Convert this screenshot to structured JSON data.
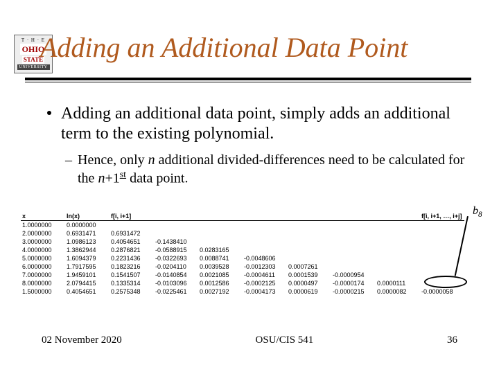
{
  "logo": {
    "line1": "T · H · E",
    "line2": "OHIO",
    "line3": "STATE",
    "line4": "UNIVERSITY"
  },
  "title": "Adding an Additional Data Point",
  "bullets": {
    "b1": "Adding an additional data point, simply adds an additional term to the existing polynomial.",
    "b2_pre": "Hence, only ",
    "b2_n": "n",
    "b2_mid": " additional divided-differences need to be calculated for the ",
    "b2_n1": "n",
    "b2_plus": "+1",
    "b2_sup": "st",
    "b2_post": " data point."
  },
  "b8_label": "b",
  "b8_sub": "8",
  "table": {
    "headers": [
      "x",
      "ln(x)",
      "f[i, i+1]",
      "",
      "",
      "",
      "",
      "",
      "",
      "f[i, i+1, …, i+j]"
    ],
    "rows": [
      [
        "1.0000000",
        "0.0000000",
        "",
        "",
        "",
        "",
        "",
        "",
        "",
        ""
      ],
      [
        "2.0000000",
        "0.6931471",
        "0.6931472",
        "",
        "",
        "",
        "",
        "",
        "",
        ""
      ],
      [
        "3.0000000",
        "1.0986123",
        "0.4054651",
        "-0.1438410",
        "",
        "",
        "",
        "",
        "",
        ""
      ],
      [
        "4.0000000",
        "1.3862944",
        "0.2876821",
        "-0.0588915",
        "0.0283165",
        "",
        "",
        "",
        "",
        ""
      ],
      [
        "5.0000000",
        "1.6094379",
        "0.2231436",
        "-0.0322693",
        "0.0088741",
        "-0.0048606",
        "",
        "",
        "",
        ""
      ],
      [
        "6.0000000",
        "1.7917595",
        "0.1823216",
        "-0.0204110",
        "0.0039528",
        "-0.0012303",
        "0.0007261",
        "",
        "",
        ""
      ],
      [
        "7.0000000",
        "1.9459101",
        "0.1541507",
        "-0.0140854",
        "0.0021085",
        "-0.0004611",
        "0.0001539",
        "-0.0000954",
        "",
        ""
      ],
      [
        "8.0000000",
        "2.0794415",
        "0.1335314",
        "-0.0103096",
        "0.0012586",
        "-0.0002125",
        "0.0000497",
        "-0.0000174",
        "0.0000111",
        ""
      ],
      [
        "1.5000000",
        "0.4054651",
        "0.2575348",
        "-0.0225461",
        "0.0027192",
        "-0.0004173",
        "0.0000619",
        "-0.0000215",
        "0.0000082",
        "-0.0000058"
      ]
    ]
  },
  "footer": {
    "left": "02 November 2020",
    "center": "OSU/CIS 541",
    "right": "36"
  }
}
